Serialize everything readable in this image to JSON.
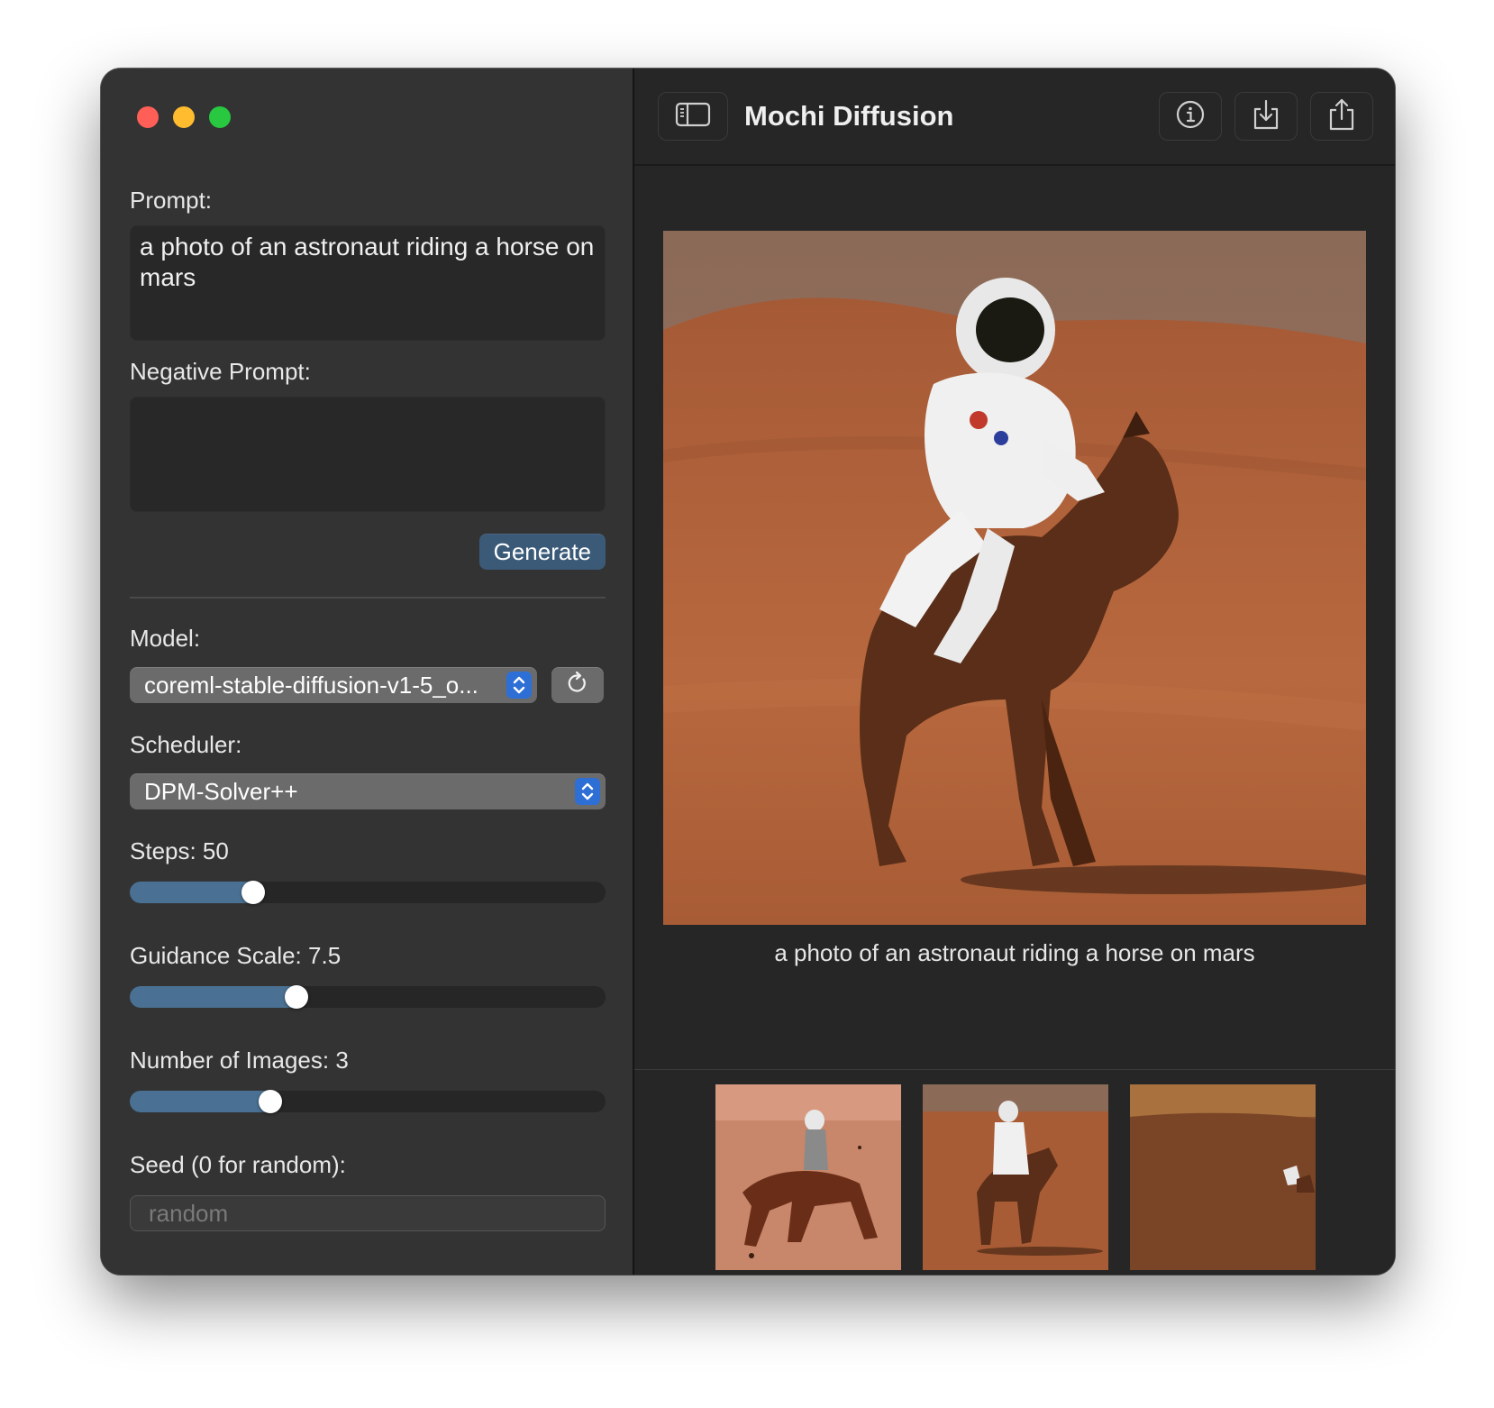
{
  "window": {
    "title": "Mochi Diffusion"
  },
  "sidebar": {
    "prompt_label": "Prompt:",
    "prompt_value": "a photo of an astronaut riding a horse on mars",
    "negative_label": "Negative Prompt:",
    "negative_value": "",
    "generate_label": "Generate",
    "model_label": "Model:",
    "model_value": "coreml-stable-diffusion-v1-5_o...",
    "scheduler_label": "Scheduler:",
    "scheduler_value": "DPM-Solver++",
    "steps_label": "Steps: 50",
    "steps_fraction": 0.26,
    "guidance_label": "Guidance Scale: 7.5",
    "guidance_fraction": 0.35,
    "num_images_label": "Number of Images: 3",
    "num_images_fraction": 0.295,
    "seed_label": "Seed (0 for random):",
    "seed_placeholder": "random",
    "seed_value": ""
  },
  "toolbar": {
    "icons": [
      "sidebar-toggle-icon",
      "info-icon",
      "save-download-icon",
      "share-icon"
    ]
  },
  "main": {
    "caption": "a photo of an astronaut riding a horse on mars",
    "thumbnails": [
      "thumbnail-1",
      "thumbnail-2",
      "thumbnail-3"
    ]
  },
  "colors": {
    "accent": "#2e6fd6",
    "generate_button": "#3a5a78",
    "slider_fill": "#4a7193",
    "traffic_close": "#ff5f57",
    "traffic_minimize": "#febc2e",
    "traffic_maximize": "#28c840"
  }
}
